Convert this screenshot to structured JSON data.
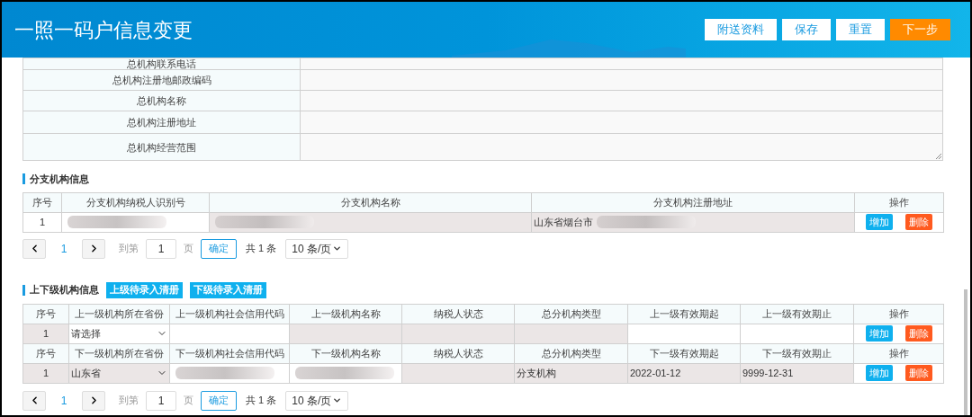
{
  "header": {
    "title": "一照一码户信息变更",
    "buttons": [
      {
        "label": "附送资料",
        "kind": "plain"
      },
      {
        "label": "保存",
        "kind": "plain"
      },
      {
        "label": "重置",
        "kind": "plain"
      },
      {
        "label": "下一步",
        "kind": "primary"
      }
    ]
  },
  "hq_fields": [
    {
      "label": "总机构联系电话",
      "kind": "input"
    },
    {
      "label": "总机构注册地邮政编码",
      "kind": "input"
    },
    {
      "label": "总机构名称",
      "kind": "input"
    },
    {
      "label": "总机构注册地址",
      "kind": "input"
    },
    {
      "label": "总机构经营范围",
      "kind": "textarea"
    }
  ],
  "branch": {
    "title": "分支机构信息",
    "columns": [
      "序号",
      "分支机构纳税人识别号",
      "分支机构名称",
      "分支机构注册地址",
      "操作"
    ],
    "rows": [
      {
        "cells": [
          {
            "kind": "text",
            "text": "1",
            "readonly": false
          },
          {
            "kind": "text",
            "redacted": true,
            "readonly": false
          },
          {
            "kind": "text",
            "redacted": true,
            "readonly": true
          },
          {
            "kind": "text",
            "text": "山东省烟台市",
            "redacted": true,
            "readonly": true
          }
        ],
        "actions": [
          {
            "label": "增加",
            "kind": "add"
          },
          {
            "label": "删除",
            "kind": "delete"
          }
        ]
      }
    ],
    "pagination": {
      "pages": [
        {
          "label": "1",
          "selected": true
        }
      ],
      "goto_label": "到第",
      "goto_value": "1",
      "page_unit": "页",
      "confirm": "确定",
      "total": "共 1 条",
      "page_size": "10 条/页"
    }
  },
  "relations": {
    "title": "上下级机构信息",
    "buttons": [
      "上级待录入清册",
      "下级待录入清册"
    ],
    "groups": [
      {
        "columns": [
          "序号",
          "上一级机构所在省份",
          "上一级机构社会信用代码",
          "上一级机构名称",
          "纳税人状态",
          "总分机构类型",
          "上一级有效期起",
          "上一级有效期止",
          "操作"
        ],
        "rows": [
          {
            "cells": [
              {
                "kind": "text",
                "text": "1",
                "readonly": true
              },
              {
                "kind": "select",
                "text": "请选择",
                "readonly": false
              },
              {
                "kind": "input",
                "readonly": false
              },
              {
                "kind": "text",
                "readonly": true
              },
              {
                "kind": "text",
                "readonly": true
              },
              {
                "kind": "text",
                "readonly": true
              },
              {
                "kind": "input",
                "readonly": false
              },
              {
                "kind": "input",
                "readonly": false
              }
            ],
            "actions": [
              {
                "label": "增加",
                "kind": "add"
              },
              {
                "label": "删除",
                "kind": "delete"
              }
            ]
          }
        ]
      },
      {
        "columns": [
          "序号",
          "下一级机构所在省份",
          "下一级机构社会信用代码",
          "下一级机构名称",
          "纳税人状态",
          "总分机构类型",
          "下一级有效期起",
          "下一级有效期止",
          "操作"
        ],
        "rows": [
          {
            "cells": [
              {
                "kind": "text",
                "text": "1",
                "readonly": true
              },
              {
                "kind": "select",
                "text": "山东省",
                "readonly": true
              },
              {
                "kind": "text",
                "redacted": true,
                "readonly": false
              },
              {
                "kind": "text",
                "redacted": true,
                "readonly": false
              },
              {
                "kind": "text",
                "readonly": true
              },
              {
                "kind": "text",
                "text": "分支机构",
                "readonly": true
              },
              {
                "kind": "text",
                "text": "2022-01-12",
                "readonly": true
              },
              {
                "kind": "text",
                "text": "9999-12-31",
                "readonly": true
              }
            ],
            "actions": [
              {
                "label": "增加",
                "kind": "add"
              },
              {
                "label": "删除",
                "kind": "delete"
              }
            ]
          }
        ]
      }
    ],
    "pagination": {
      "pages": [
        {
          "label": "1",
          "selected": true
        }
      ],
      "goto_label": "到第",
      "goto_value": "1",
      "page_unit": "页",
      "confirm": "确定",
      "total": "共 1 条",
      "page_size": "10 条/页"
    }
  }
}
